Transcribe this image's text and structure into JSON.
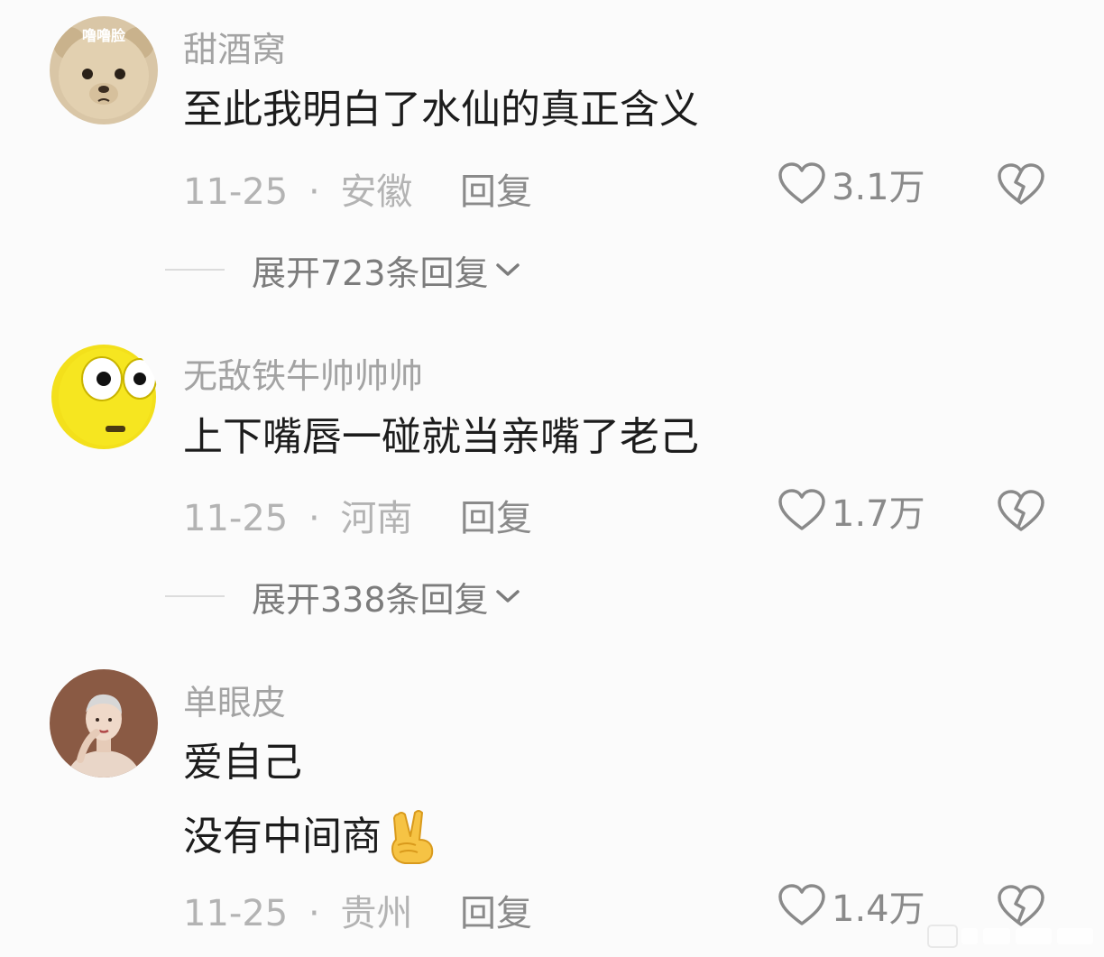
{
  "comments": [
    {
      "avatar_icon": "teddy-bear-avatar-icon",
      "avatar_text": "噜噜脸",
      "username": "甜酒窝",
      "lines": [
        "至此我明白了水仙的真正含义"
      ],
      "date": "11-25",
      "separator": "·",
      "location": "安徽",
      "reply_label": "回复",
      "likes": "3.1万",
      "expand_label": "展开723条回复"
    },
    {
      "avatar_icon": "yellow-emoji-avatar-icon",
      "username": "无敌铁牛帅帅帅",
      "lines": [
        "上下嘴唇一碰就当亲嘴了老己"
      ],
      "date": "11-25",
      "separator": "·",
      "location": "河南",
      "reply_label": "回复",
      "likes": "1.7万",
      "expand_label": "展开338条回复"
    },
    {
      "avatar_icon": "person-illustration-avatar-icon",
      "username": "单眼皮",
      "lines": [
        "爱自己",
        "没有中间商"
      ],
      "emoji_icon": "victory-hand-emoji-icon",
      "date": "11-25",
      "separator": "·",
      "location": "贵州",
      "reply_label": "回复",
      "likes": "1.4万"
    }
  ],
  "colors": {
    "background": "#fbfbfb",
    "username": "#a3a3a3",
    "text": "#1c1c1c",
    "meta": "#b3b3b3",
    "action": "#8a8a8a"
  },
  "icons": {
    "like": "heart-outline-icon",
    "dislike": "broken-heart-icon",
    "expand": "chevron-down-icon"
  }
}
